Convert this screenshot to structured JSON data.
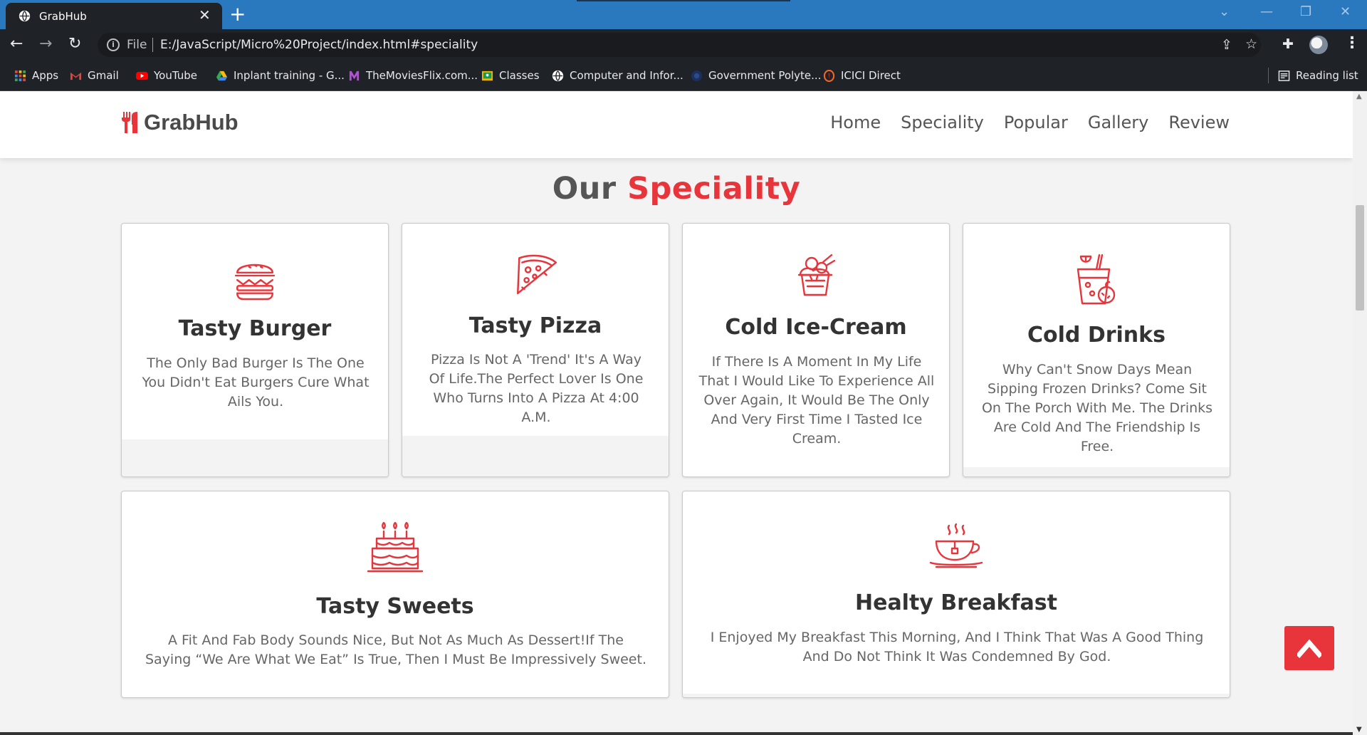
{
  "browser": {
    "tab_title": "GrabHub",
    "tab_close": "✕",
    "new_tab": "+",
    "address_prefix": "File",
    "address_url": "E:/JavaScript/Micro%20Project/index.html#speciality",
    "bookmarks": [
      {
        "label": "Apps",
        "icon": "apps-grid-icon"
      },
      {
        "label": "Gmail",
        "icon": "gmail-icon"
      },
      {
        "label": "YouTube",
        "icon": "youtube-icon"
      },
      {
        "label": "Inplant training - G...",
        "icon": "google-drive-icon"
      },
      {
        "label": "TheMoviesFlix.com...",
        "icon": "moviesflix-icon"
      },
      {
        "label": "Classes",
        "icon": "classroom-icon"
      },
      {
        "label": "Computer and Infor...",
        "icon": "globe-icon"
      },
      {
        "label": "Government Polyte...",
        "icon": "college-icon"
      },
      {
        "label": "ICICI Direct",
        "icon": "icici-icon"
      }
    ],
    "reading_list": "Reading list"
  },
  "site": {
    "logo_text": "GrabHub",
    "nav": [
      "Home",
      "Speciality",
      "Popular",
      "Gallery",
      "Review"
    ]
  },
  "section": {
    "heading_plain": "Our",
    "heading_accent": "Speciality"
  },
  "cards": [
    {
      "title": "Tasty Burger",
      "text": "The Only Bad Burger Is The One You Didn't Eat Burgers Cure What Ails You.",
      "icon": "burger-icon"
    },
    {
      "title": "Tasty Pizza",
      "text": "Pizza Is Not A 'Trend' It's A Way Of Life.The Perfect Lover Is One Who Turns Into A Pizza At 4:00 A.M.",
      "icon": "pizza-icon"
    },
    {
      "title": "Cold Ice-Cream",
      "text": "If There Is A Moment In My Life That I Would Like To Experience All Over Again, It Would Be The Only And Very First Time I Tasted Ice Cream.",
      "icon": "ice-cream-icon"
    },
    {
      "title": "Cold Drinks",
      "text": "Why Can't Snow Days Mean Sipping Frozen Drinks? Come Sit On The Porch With Me. The Drinks Are Cold And The Friendship Is Free.",
      "icon": "cold-drink-icon"
    },
    {
      "title": "Tasty Sweets",
      "text": "A Fit And Fab Body Sounds Nice, But Not As Much As Dessert!If The Saying “We Are What We Eat” Is True, Then I Must Be Impressively Sweet.",
      "icon": "cake-icon"
    },
    {
      "title": "Healty Breakfast",
      "text": "I Enjoyed My Breakfast This Morning, And I Think That Was A Good Thing And Do Not Think It Was Condemned By God.",
      "icon": "coffee-cup-icon"
    }
  ],
  "colors": {
    "accent": "#e8353b",
    "chrome_tab_strip": "#2a79bf",
    "chrome_toolbar": "#1f2227",
    "page_bg": "#f3f3f3"
  }
}
